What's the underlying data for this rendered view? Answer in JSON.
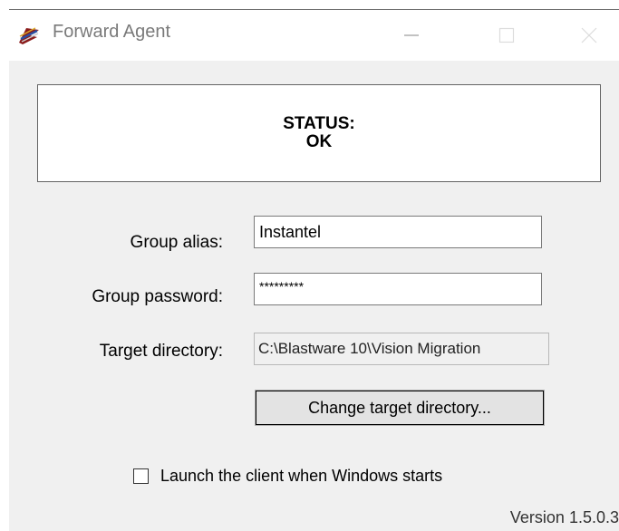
{
  "window": {
    "title": "Forward Agent",
    "app_icon": "forward-agent-icon",
    "controls": {
      "minimize_icon": "minimize-icon",
      "maximize_icon": "maximize-icon",
      "close_icon": "close-icon"
    }
  },
  "status": {
    "label": "STATUS:",
    "value": "OK"
  },
  "form": {
    "group_alias": {
      "label": "Group alias:",
      "value": "Instantel"
    },
    "group_password": {
      "label": "Group password:",
      "value": "*********"
    },
    "target_directory": {
      "label": "Target directory:",
      "value": "C:\\Blastware 10\\Vision Migration"
    },
    "change_button": "Change target directory...",
    "launch_checkbox": {
      "label": "Launch the client when Windows starts",
      "checked": false
    }
  },
  "footer": {
    "version": "Version 1.5.0.3"
  },
  "colors": {
    "client_bg": "#f0f0f0",
    "title_text": "#7a7a7a",
    "border": "#646464"
  }
}
